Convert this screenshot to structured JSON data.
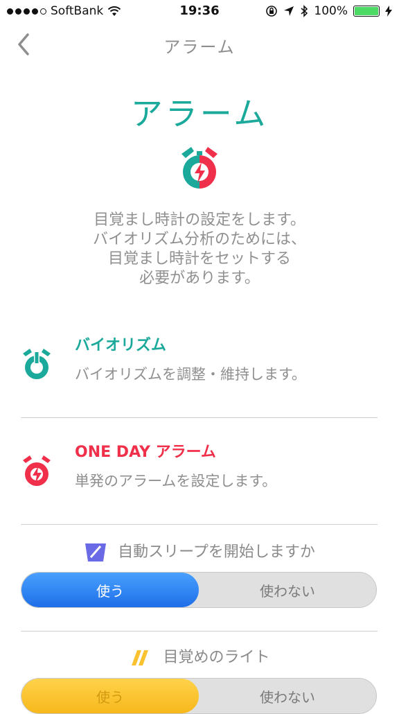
{
  "status_bar": {
    "carrier": "SoftBank",
    "time": "19:36",
    "battery": "100%"
  },
  "nav": {
    "title": "アラーム"
  },
  "hero": {
    "title": "アラーム",
    "description_lines": [
      "目覚まし時計の設定をします。",
      "バイオリズム分析のためには、",
      "目覚まし時計をセットする",
      "必要があります。"
    ]
  },
  "options": [
    {
      "title": "バイオリズム",
      "subtitle": "バイオリズムを調整・維持します。",
      "color": "#1aa99a"
    },
    {
      "title": "ONE DAY アラーム",
      "subtitle": "単発のアラームを設定します。",
      "color": "#f0304a"
    }
  ],
  "auto_sleep": {
    "question": "自動スリープを開始しますか",
    "on_label": "使う",
    "off_label": "使わない"
  },
  "wake_light": {
    "question": "目覚めのライト",
    "on_label": "使う",
    "off_label": "使わない"
  },
  "colors": {
    "accent": "#1aa99a",
    "alert": "#f0304a",
    "toggle_blue": "#2a7ff0",
    "toggle_yellow": "#f9c22e"
  }
}
